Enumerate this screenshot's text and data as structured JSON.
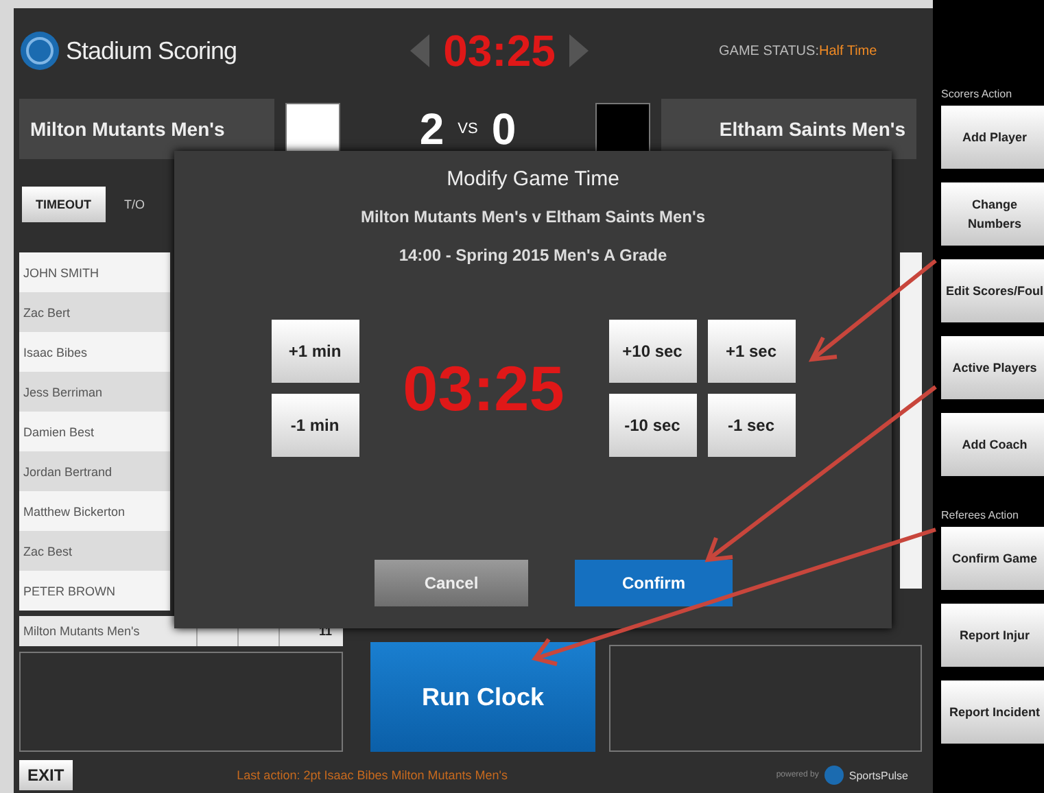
{
  "app": {
    "title": "Stadium Scoring"
  },
  "header": {
    "clock": "03:25",
    "game_status_label": "GAME STATUS:",
    "game_status": "Half Time"
  },
  "teams": {
    "home": {
      "name": "Milton Mutants Men's",
      "color": "#ffffff",
      "score": "2"
    },
    "vs": "VS",
    "away": {
      "name": "Eltham Saints Men's",
      "color": "#000000",
      "score": "0"
    }
  },
  "timeout_button": "TIMEOUT",
  "timeout_label": "T/O",
  "players": [
    "JOHN SMITH",
    "Zac Bert",
    "Isaac Bibes",
    "Jess Berriman",
    "Damien Best",
    "Jordan Bertrand",
    "Matthew Bickerton",
    "Zac Best",
    "PETER BROWN"
  ],
  "team_total_row": {
    "name": "Milton Mutants Men's",
    "value": "11"
  },
  "run_clock_button": "Run Clock",
  "footer": {
    "exit_button": "EXIT",
    "last_action": "Last action: 2pt Isaac Bibes Milton Mutants Men's",
    "powered_by": "powered by",
    "brand": "SportsPulse"
  },
  "sidebar": [
    {
      "title": "Scorers Action",
      "buttons": [
        "Add Player",
        "Change Numbers",
        "Edit Scores/Foul",
        "Active Players",
        "Add Coach"
      ]
    },
    {
      "title": "Referees Action",
      "buttons": [
        "Confirm Game",
        "Report Injur",
        "Report Incident"
      ]
    }
  ],
  "modal": {
    "title": "Modify Game Time",
    "match": "Milton Mutants Men's v Eltham Saints Men's",
    "details": "14:00 - Spring 2015 Men's A Grade",
    "clock": "03:25",
    "minute_buttons": [
      "+1 min",
      "-1 min"
    ],
    "second_buttons": [
      "+10 sec",
      "+1 sec",
      "-10 sec",
      "-1 sec"
    ],
    "cancel_button": "Cancel",
    "confirm_button": "Confirm"
  }
}
